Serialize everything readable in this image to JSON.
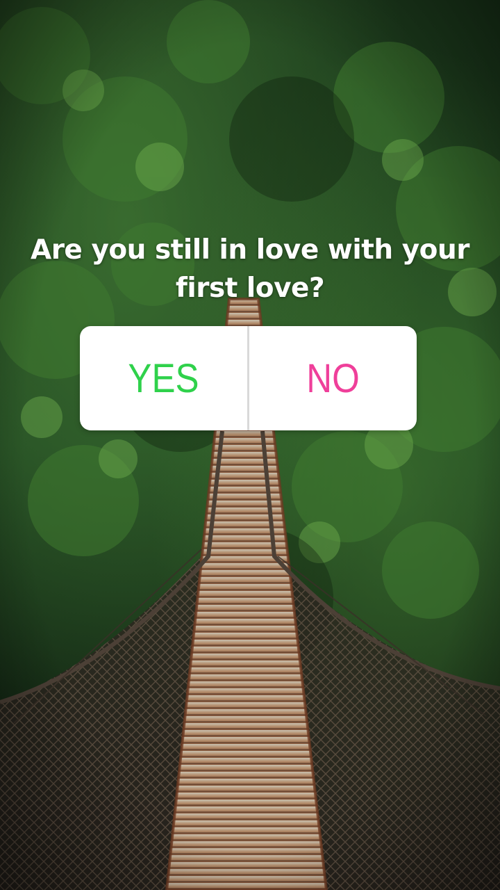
{
  "story": {
    "question_line1": "Are you still in love with your",
    "question_line2": "first love?",
    "poll": {
      "yes_label": "YES",
      "no_label": "NO",
      "yes_color": "#2fd14b",
      "no_color": "#ef3f9a"
    }
  }
}
